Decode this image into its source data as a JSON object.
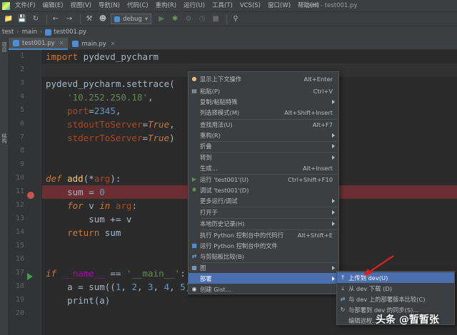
{
  "menubar": {
    "items": [
      "文件(F)",
      "编辑(E)",
      "视图(V)",
      "导航(N)",
      "代码(C)",
      "重构(R)",
      "运行(U)",
      "工具(T)",
      "VCS(S)",
      "窗口(W)",
      "帮助(H)"
    ],
    "window_title": "test - test001.py"
  },
  "toolbar": {
    "run_config": "debug"
  },
  "breadcrumb": {
    "items": [
      "test",
      "main",
      "test001.py"
    ]
  },
  "left_strip": {
    "labels": [
      "项目",
      "结构"
    ]
  },
  "tabs": [
    {
      "label": "test001.py",
      "active": true
    },
    {
      "label": "main.py",
      "active": false
    }
  ],
  "editor": {
    "line_numbers": [
      "1",
      "2",
      "3",
      "4",
      "5",
      "6",
      "7",
      "8",
      "9",
      "10",
      "11",
      "12",
      "13",
      "14",
      "15",
      "16",
      "17",
      "18",
      "19",
      "20"
    ],
    "breakpoint_line": "12",
    "run_line": "17"
  },
  "context_menu": {
    "items": [
      {
        "label": "显示上下文操作",
        "shortcut": "Alt+Enter"
      },
      {
        "label": "粘贴(P)",
        "shortcut": "Ctrl+V"
      },
      {
        "label": "复制/粘贴特殊",
        "shortcut": ""
      },
      {
        "label": "列选择模式(M)",
        "shortcut": "Alt+Shift+Insert"
      },
      {
        "label": "查找用法(U)",
        "shortcut": "Alt+F7"
      },
      {
        "label": "重构(R)",
        "shortcut": ""
      },
      {
        "label": "折叠",
        "shortcut": ""
      },
      {
        "label": "转到",
        "shortcut": ""
      },
      {
        "label": "生成...",
        "shortcut": "Alt+Insert"
      },
      {
        "label": "运行 'test001'(U)",
        "shortcut": "Ctrl+Shift+F10"
      },
      {
        "label": "调试 'test001'(D)",
        "shortcut": ""
      },
      {
        "label": "更多运行/调试",
        "shortcut": ""
      },
      {
        "label": "打开于",
        "shortcut": ""
      },
      {
        "label": "本地历史记录(H)",
        "shortcut": ""
      },
      {
        "label": "执行 Python 控制台中的代码行",
        "shortcut": "Alt+Shift+E"
      },
      {
        "label": "运行 Python 控制台中的文件",
        "shortcut": ""
      },
      {
        "label": "与剪贴板比较(B)",
        "shortcut": ""
      },
      {
        "label": "图",
        "shortcut": ""
      },
      {
        "label": "部署",
        "shortcut": ""
      },
      {
        "label": "创建 Gist...",
        "shortcut": ""
      }
    ]
  },
  "submenu": {
    "items": [
      {
        "label": "上传到 dev(U)"
      },
      {
        "label": "从 dev 下载 (D)"
      },
      {
        "label": "与 dev 上的部署版本比较(C)"
      },
      {
        "label": "与部署到 dev 的同步(S)..."
      },
      {
        "label": "编辑远程..."
      }
    ]
  },
  "watermark": {
    "text": "头条 @暂暂张"
  },
  "colors": {
    "accent": "#4b6eaf",
    "breakpoint_line": "#6b2f33",
    "annotation_arrow": "#e02020"
  }
}
